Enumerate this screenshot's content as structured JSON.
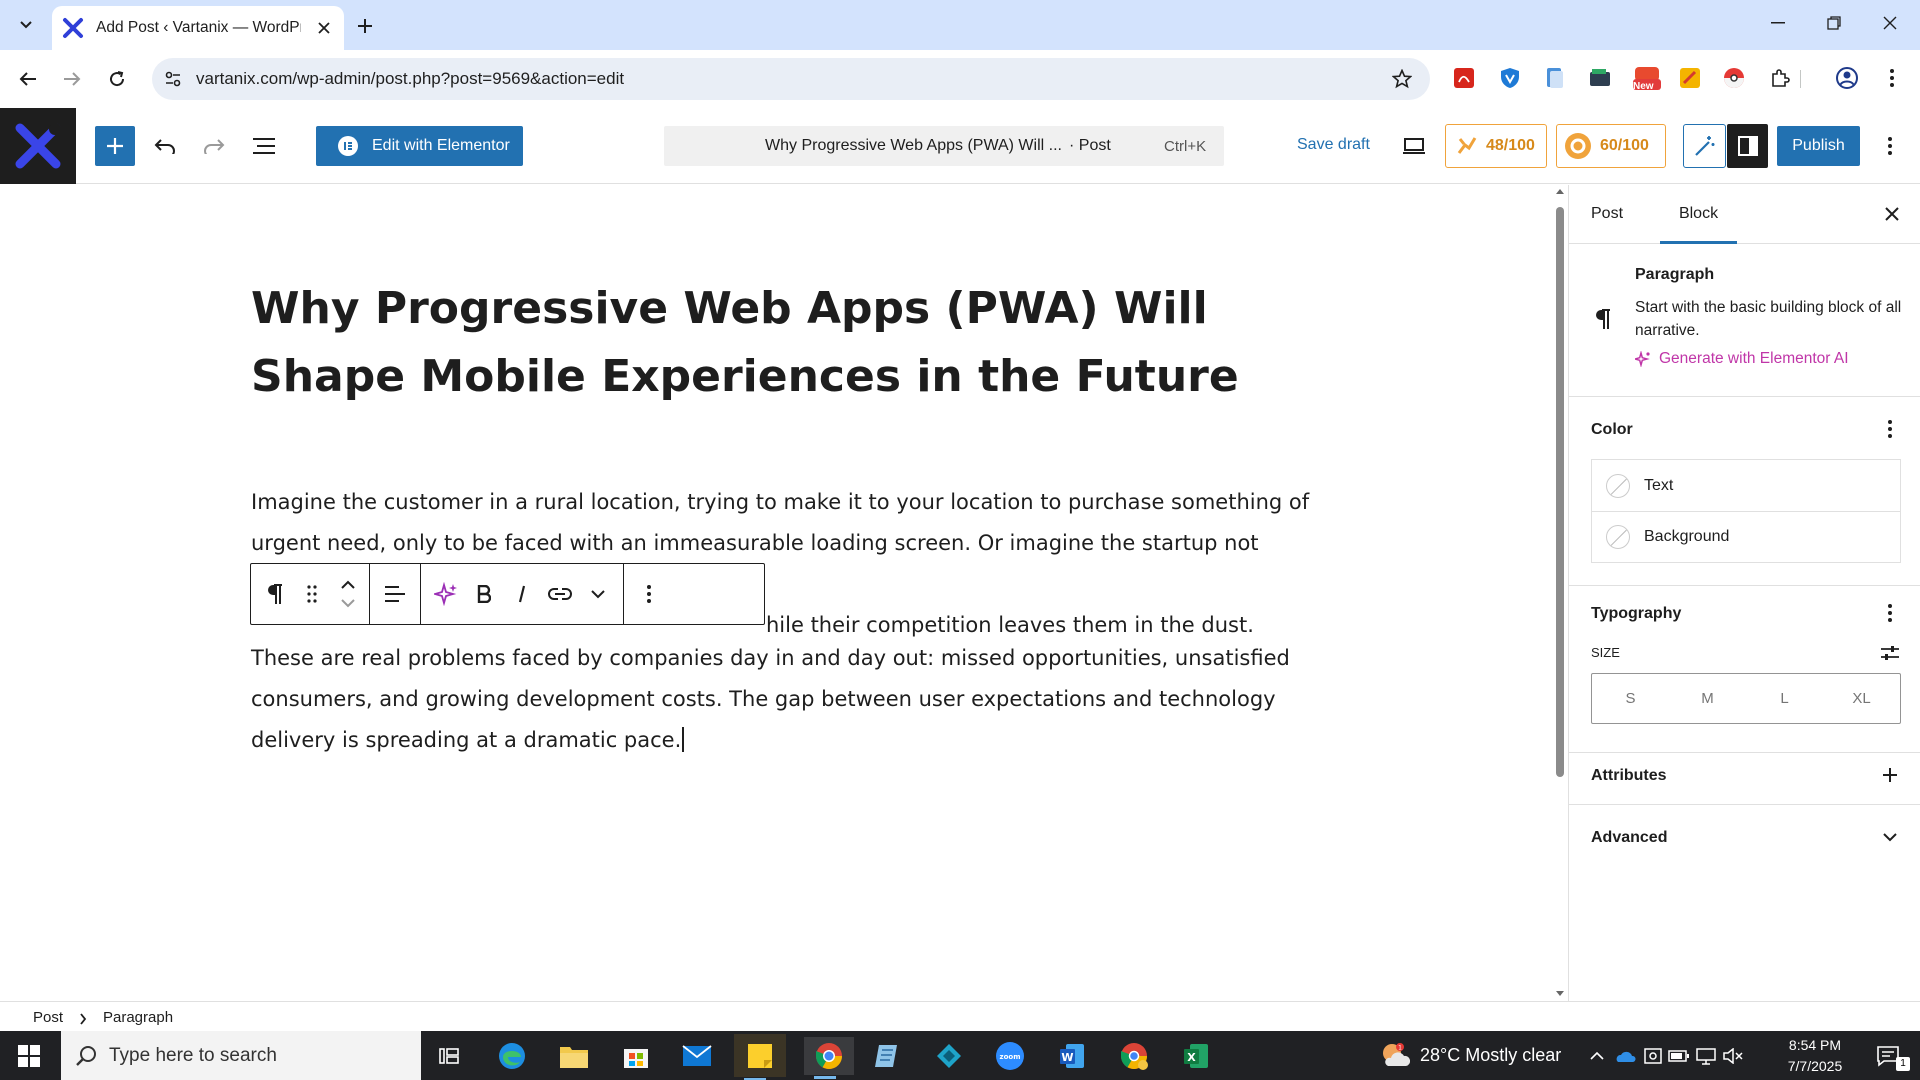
{
  "browser": {
    "tab_title": "Add Post ‹ Vartanix — WordPress",
    "url": "vartanix.com/wp-admin/post.php?post=9569&action=edit",
    "new_badge": "New"
  },
  "header": {
    "elementor_label": "Edit with Elementor",
    "command_title": "Why Progressive Web Apps (PWA) Will ...",
    "command_type": "· Post",
    "command_shortcut": "Ctrl+K",
    "save_draft": "Save draft",
    "score_1": "48/100",
    "score_2": "60/100",
    "publish": "Publish"
  },
  "post": {
    "title": "Why Progressive Web Apps (PWA) Will Shape Mobile Experiences in the Future",
    "paragraph_1_line_1": "Imagine the customer in a rural location, trying to make it to your location to purchase something of",
    "paragraph_1_line_2": "urgent need, only to be faced with an immeasurable loading screen. Or imagine the startup not being",
    "paragraph_1_line_3": "hile their competition leaves them in the dust.",
    "paragraph_2": "These are real problems faced by companies day in and day out: missed opportunities, unsatisfied consumers, and growing development costs. The gap between user expectations and technology delivery is spreading at a dramatic pace."
  },
  "sidebar": {
    "tab_post": "Post",
    "tab_block": "Block",
    "block_name": "Paragraph",
    "block_desc": "Start with the basic building block of all narrative.",
    "generate_ai": "Generate with Elementor AI",
    "color_heading": "Color",
    "color_text": "Text",
    "color_background": "Background",
    "typography_heading": "Typography",
    "size_label": "SIZE",
    "sizes": [
      "S",
      "M",
      "L",
      "XL"
    ],
    "attributes_heading": "Attributes",
    "advanced_heading": "Advanced"
  },
  "breadcrumb": {
    "root": "Post",
    "current": "Paragraph"
  },
  "taskbar": {
    "search_placeholder": "Type here to search",
    "weather": "28°C  Mostly clear",
    "time": "8:54 PM",
    "date": "7/7/2025",
    "notification_count": "1"
  },
  "colors": {
    "wp_blue": "#2271b1",
    "score_orange": "#f0a33b",
    "elementor_ai_pink": "#c036a8",
    "tab_strip": "#d3e3fd"
  }
}
